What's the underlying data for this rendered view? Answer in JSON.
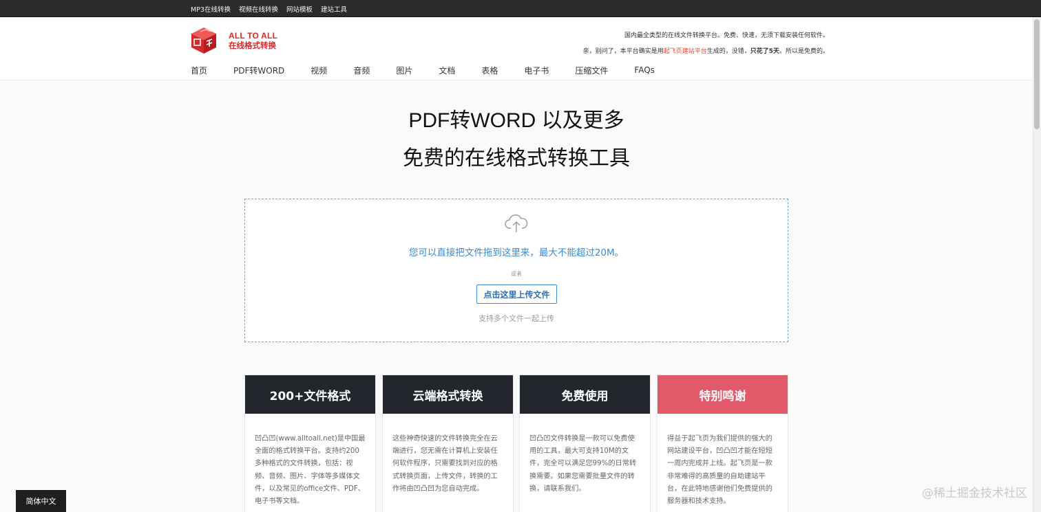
{
  "topbar": {
    "links": [
      "MP3在线转换",
      "视频在线转换",
      "网站模板",
      "建站工具"
    ]
  },
  "logo": {
    "en": "ALL TO ALL",
    "cn": "在线格式转换"
  },
  "notice": {
    "line1": "国内最全类型的在线文件转换平台。免费、快速，无须下载安装任何软件。",
    "line2_prefix": "亲，别问了，本平台确实是用",
    "line2_link": "起飞页建站平台",
    "line2_middle": "生成的，没错，",
    "line2_bold": "只花了5天",
    "line2_suffix": "。所以是免费的。"
  },
  "nav": {
    "items": [
      "首页",
      "PDF转WORD",
      "视频",
      "音频",
      "图片",
      "文档",
      "表格",
      "电子书",
      "压缩文件",
      "FAQs"
    ]
  },
  "hero": {
    "line1": "PDF转WORD 以及更多",
    "line2": "免费的在线格式转换工具"
  },
  "dropzone": {
    "icon": "cloud-upload-icon",
    "message": "您可以直接把文件拖到这里来，最大不能超过20M。",
    "or": "或者",
    "button": "点击这里上传文件",
    "multi": "支持多个文件一起上传"
  },
  "cards": [
    {
      "title": "200+文件格式",
      "text": "凹凸凹(www.alltoall.net)是中国最全面的格式转换平台。支持约200多种格式的文件转换，包括：视频、音频、图片、字体等多媒体文件，以及常见的office文件、PDF、电子书等文档。"
    },
    {
      "title": "云端格式转换",
      "text": "这些神奇快速的文件转换完全在云端进行，您无需在计算机上安装任何软件程序，只需要找到对应的格式转换页面，上传文件，转换的工作将由凹凸凹为您自动完成。"
    },
    {
      "title": "免费使用",
      "text": "凹凸凹文件转换是一款可以免费使用的工具，最大可支持10M的文件，完全可以满足您99%的日常转换需要。如果您需要批量文件的转换，请联系我们。"
    },
    {
      "title": "特别鸣谢",
      "text": "得益于起飞页为我们提供的强大的网站建设平台，凹凸凹才能在短短一周内完成并上线。起飞页是一款非常难得的高质量的自助建站平台，在此特地感谢他们免费提供的服务器和技术支持。"
    }
  ],
  "language": "简体中文",
  "watermark": "@稀土掘金技术社区",
  "colors": {
    "topbar": "#2b2b2b",
    "brand_red": "#d9292b",
    "drop_blue": "#3a8ad0",
    "card_dark": "#23262c",
    "card_pink": "#e05a6a"
  }
}
